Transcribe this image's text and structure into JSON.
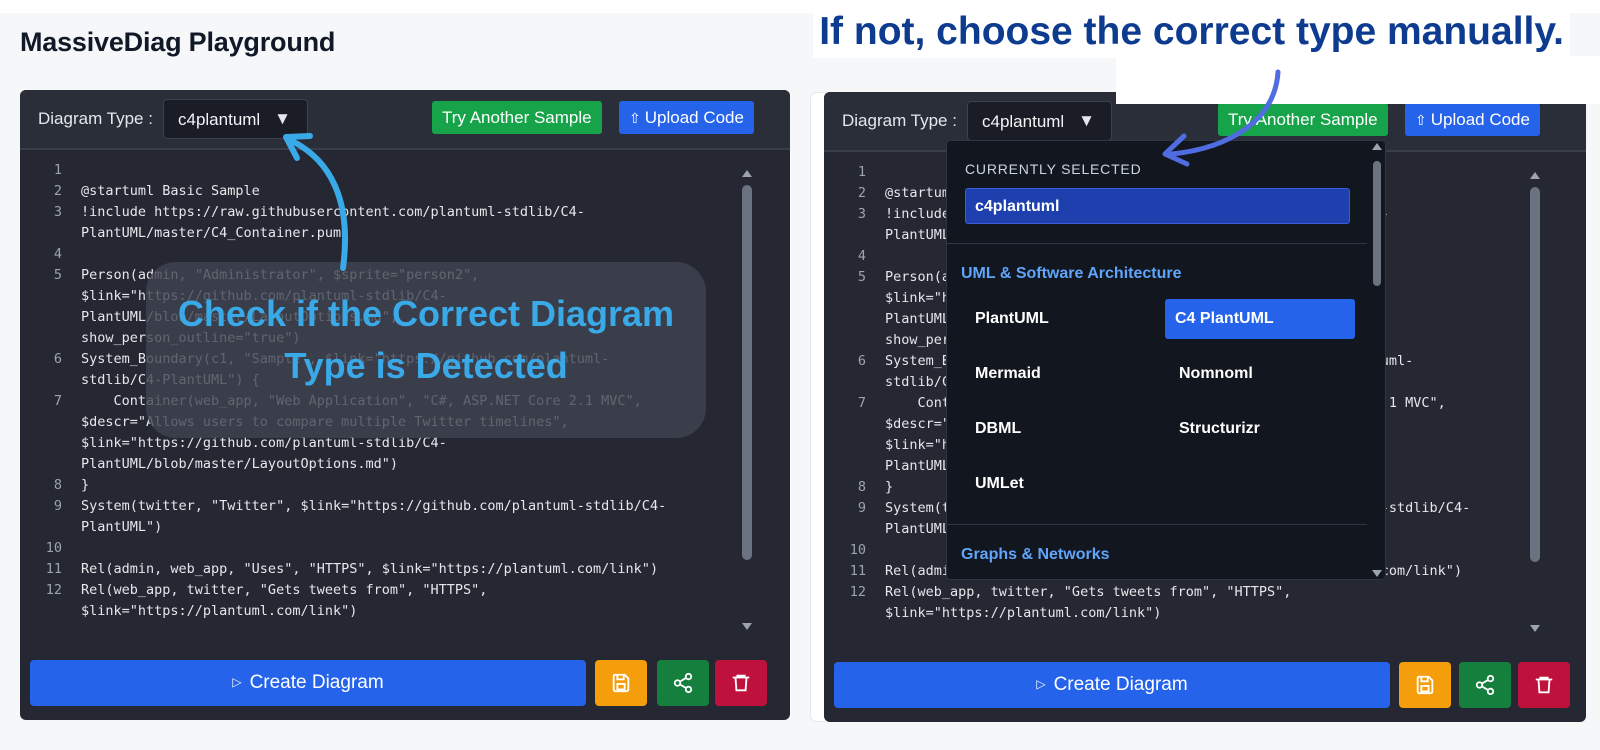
{
  "app": {
    "title": "MassiveDiag Playground"
  },
  "headline": "If not, choose the correct type manually.",
  "overlay": {
    "line1": "Check if the Correct Diagram",
    "line2": "Type is Detected"
  },
  "toolbar": {
    "type_label": "Diagram Type :",
    "selected_type": "c4plantuml",
    "caret": "▼",
    "sample_button": "Try Another Sample",
    "upload_button": "Upload Code",
    "upload_icon": "upload-icon"
  },
  "actions": {
    "create_label": "Create Diagram",
    "play_glyph": "▷",
    "save_icon": "save-icon",
    "share_icon": "share-icon",
    "delete_icon": "trash-icon"
  },
  "code_left": [
    {
      "n": "1",
      "t": ""
    },
    {
      "n": "2",
      "t": "@startuml Basic Sample"
    },
    {
      "n": "3",
      "t": "!include https://raw.githubusercontent.com/plantuml-stdlib/C4-"
    },
    {
      "n": "",
      "t": "PlantUML/master/C4_Container.puml"
    },
    {
      "n": "4",
      "t": ""
    },
    {
      "n": "5",
      "t": "Person(admin, \"Administrator\", $sprite=\"person2\","
    },
    {
      "n": "",
      "t": "$link=\"https://github.com/plantuml-stdlib/C4-"
    },
    {
      "n": "",
      "t": "PlantUML/blob/master/LayoutOptions.md\","
    },
    {
      "n": "",
      "t": "show_person_outline=\"true\")"
    },
    {
      "n": "6",
      "t": "System_Boundary(c1, \"Sample\", $link=\"https://github.com/plantuml-"
    },
    {
      "n": "",
      "t": "stdlib/C4-PlantUML\") {"
    },
    {
      "n": "7",
      "t": "    Container(web_app, \"Web Application\", \"C#, ASP.NET Core 2.1 MVC\","
    },
    {
      "n": "",
      "t": "$descr=\"Allows users to compare multiple Twitter timelines\","
    },
    {
      "n": "",
      "t": "$link=\"https://github.com/plantuml-stdlib/C4-"
    },
    {
      "n": "",
      "t": "PlantUML/blob/master/LayoutOptions.md\")"
    },
    {
      "n": "8",
      "t": "}"
    },
    {
      "n": "9",
      "t": "System(twitter, \"Twitter\", $link=\"https://github.com/plantuml-stdlib/C4-"
    },
    {
      "n": "",
      "t": "PlantUML\")"
    },
    {
      "n": "10",
      "t": ""
    },
    {
      "n": "11",
      "t": "Rel(admin, web_app, \"Uses\", \"HTTPS\", $link=\"https://plantuml.com/link\")"
    },
    {
      "n": "12",
      "t": "Rel(web_app, twitter, \"Gets tweets from\", \"HTTPS\","
    },
    {
      "n": "",
      "t": "$link=\"https://plantuml.com/link\")"
    }
  ],
  "dropdown": {
    "current_label": "CURRENTLY SELECTED",
    "current_value": "c4plantuml",
    "group1": "UML & Software Architecture",
    "items": [
      "PlantUML",
      "C4 PlantUML",
      "Mermaid",
      "Nomnoml",
      "DBML",
      "Structurizr",
      "UMLet"
    ],
    "selected_item": "C4 PlantUML",
    "group2": "Graphs & Networks"
  },
  "colors": {
    "headline": "#0d3b8f",
    "overlay_text": "#3aa9e8",
    "arrow_left": "#3aa9e8",
    "arrow_right": "#4f6ce0",
    "primary": "#2563eb",
    "success": "#16a34a",
    "warning": "#f59e0b",
    "danger": "#be123c"
  }
}
